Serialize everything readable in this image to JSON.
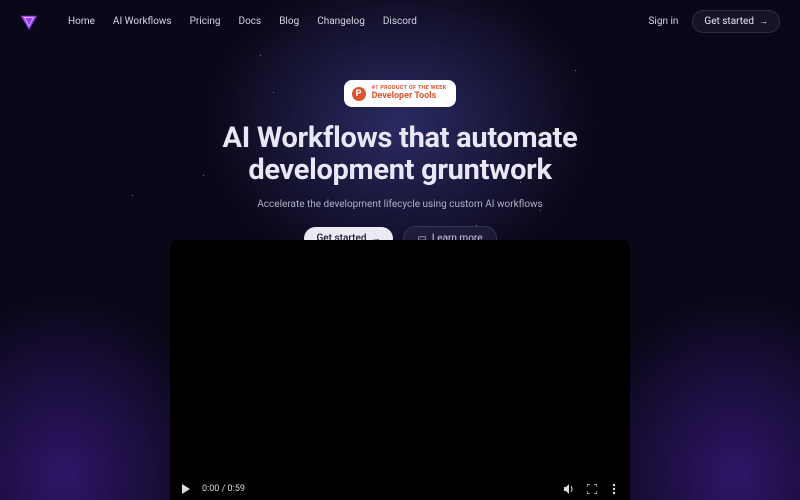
{
  "nav": {
    "items": [
      {
        "label": "Home"
      },
      {
        "label": "AI Workflows"
      },
      {
        "label": "Pricing"
      },
      {
        "label": "Docs"
      },
      {
        "label": "Blog"
      },
      {
        "label": "Changelog"
      },
      {
        "label": "Discord"
      }
    ],
    "sign_in": "Sign in",
    "get_started": "Get started"
  },
  "badge": {
    "small": "#1 Product of the Week",
    "big": "Developer Tools",
    "letter": "P"
  },
  "hero": {
    "title": "AI Workflows that automate development gruntwork",
    "subtitle": "Accelerate the development lifecycle using custom AI workflows",
    "cta_primary": "Get started",
    "cta_secondary": "Learn more"
  },
  "video": {
    "time": "0:00 / 0:59"
  },
  "colors": {
    "accent_purple": "#7b3ff2",
    "producthunt": "#da552f",
    "bg": "#0a0718"
  }
}
